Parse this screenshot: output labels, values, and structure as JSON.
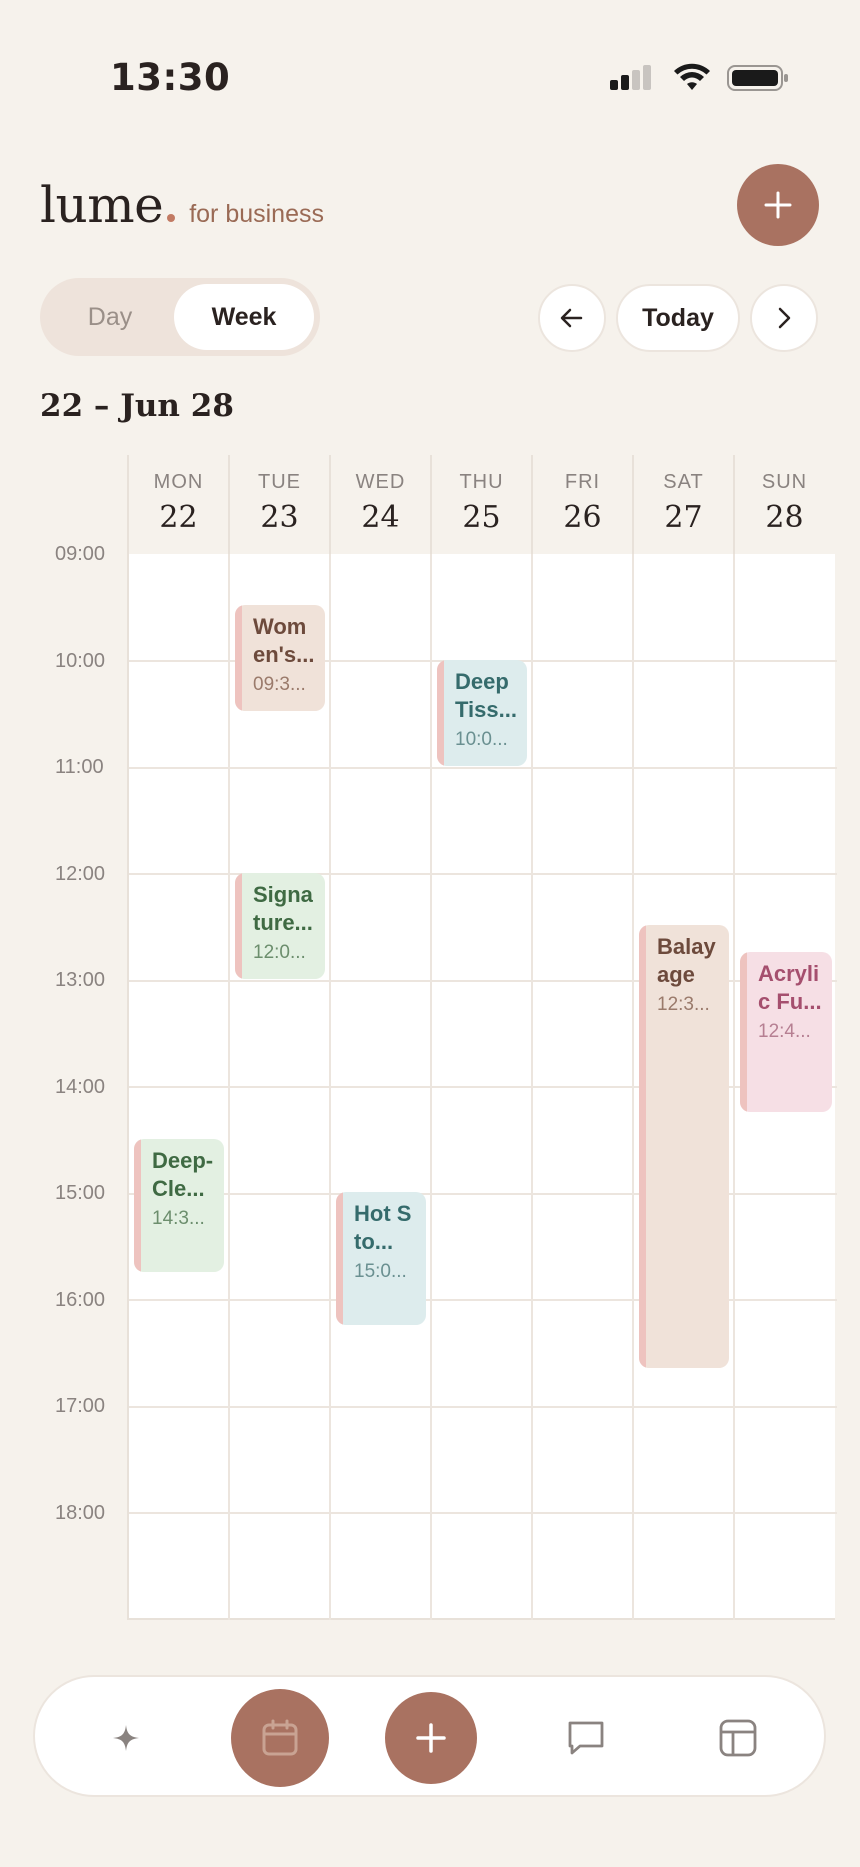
{
  "status_bar": {
    "time": "13:30"
  },
  "header": {
    "brand": "lume",
    "tagline": "for business",
    "add_icon": "plus-icon"
  },
  "view_toggle": {
    "day": "Day",
    "week": "Week",
    "selected": "Week"
  },
  "nav": {
    "prev_icon": "arrow-left-icon",
    "today": "Today",
    "next_icon": "chevron-right-icon"
  },
  "range_title": "22 – Jun 28",
  "days": [
    {
      "dow": "MON",
      "num": "22"
    },
    {
      "dow": "TUE",
      "num": "23"
    },
    {
      "dow": "WED",
      "num": "24"
    },
    {
      "dow": "THU",
      "num": "25"
    },
    {
      "dow": "FRI",
      "num": "26"
    },
    {
      "dow": "SAT",
      "num": "27"
    },
    {
      "dow": "SUN",
      "num": "28"
    }
  ],
  "hours": [
    "09:00",
    "10:00",
    "11:00",
    "12:00",
    "13:00",
    "14:00",
    "15:00",
    "16:00",
    "17:00",
    "18:00"
  ],
  "events": [
    {
      "title": "Wom en's...",
      "time": "09:3...",
      "color": "#f0e2d9"
    },
    {
      "title": "Deep Tiss...",
      "time": "10:0...",
      "color": "#ddeced"
    },
    {
      "title": "Signa ture...",
      "time": "12:0...",
      "color": "#e3f0e2"
    },
    {
      "title": "Balay age",
      "time": "12:3...",
      "color": "#f0e2d9"
    },
    {
      "title": "Acryli c Fu...",
      "time": "12:4...",
      "color": "#f6dfe5"
    },
    {
      "title": "Deep- Cle...",
      "time": "14:3...",
      "color": "#e3f0e2"
    },
    {
      "title": "Hot Sto...",
      "time": "15:0...",
      "color": "#ddeced"
    }
  ],
  "bottom_nav": {
    "items": [
      "sparkle-icon",
      "calendar-icon",
      "plus-icon",
      "chat-icon",
      "layout-icon"
    ],
    "active": "calendar-icon"
  },
  "colors": {
    "accent": "#a97261",
    "background": "#f6f2ec",
    "grid": "#ece5de"
  }
}
